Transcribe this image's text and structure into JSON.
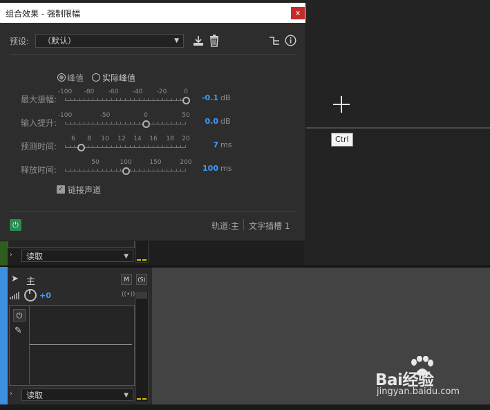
{
  "background": {
    "tooltip": "Ctrl",
    "upper_track": {
      "read_mode": "读取"
    },
    "master_track": {
      "name": "主",
      "mute_label": "M",
      "solo_label": "(S)",
      "volume": "+0",
      "read_mode": "读取"
    }
  },
  "dialog": {
    "title": "组合效果 - 强制限幅",
    "close_label": "x",
    "preset": {
      "label": "预设:",
      "value": "（默认）"
    },
    "mode": {
      "peak": "峰值",
      "true_peak": "实际峰值",
      "selected": "peak"
    },
    "params": [
      {
        "label": "最大振幅:",
        "ticks": [
          "-100",
          "-80",
          "-60",
          "-40",
          "-20",
          "0"
        ],
        "value": "-0.1",
        "unit": "dB",
        "min": -100,
        "max": 0,
        "level": -0.1
      },
      {
        "label": "输入提升:",
        "ticks": [
          "-100",
          "-50",
          "0",
          "50"
        ],
        "value": "0.0",
        "unit": "dB",
        "min": -100,
        "max": 50,
        "level": 0
      },
      {
        "label": "预测时间:",
        "ticks": [
          "6",
          "8",
          "10",
          "12",
          "14",
          "16",
          "18",
          "20"
        ],
        "value": "7",
        "unit": "ms",
        "min": 5,
        "max": 20,
        "level": 7
      },
      {
        "label": "释放时间:",
        "ticks": [
          "50",
          "100",
          "150",
          "200"
        ],
        "value": "100",
        "unit": "ms",
        "min": 0,
        "max": 200,
        "level": 100
      }
    ],
    "link_channels": {
      "label": "链接声道",
      "checked": true
    },
    "footer": {
      "track": "轨道:主",
      "slot": "文字插槽 1"
    }
  },
  "watermark": {
    "logo": "Bai经验",
    "url": "jingyan.baidu.com"
  },
  "colors": {
    "accent": "#3b9cff",
    "power": "#2c8a52",
    "close": "#c42b2b",
    "track_accent": "#3d8fe0"
  }
}
